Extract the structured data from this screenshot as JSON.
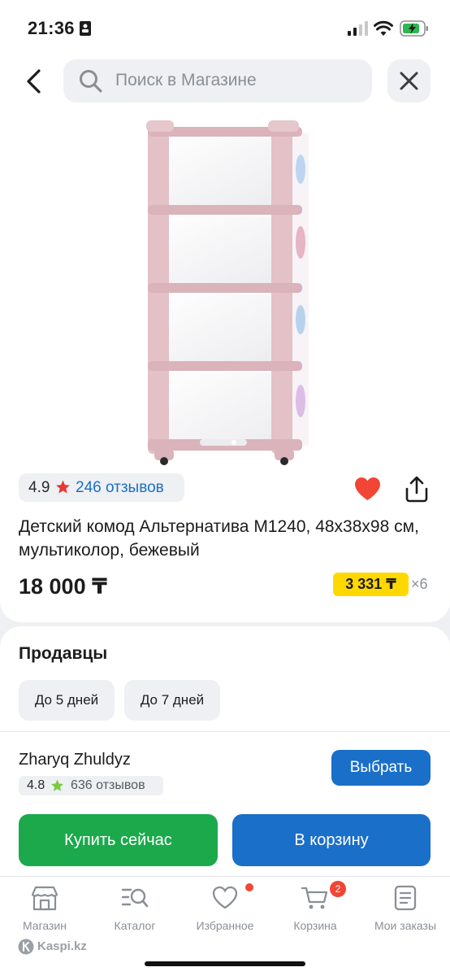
{
  "status_bar": {
    "time": "21:36"
  },
  "search": {
    "placeholder": "Поиск в Магазине"
  },
  "product": {
    "rating": "4.9",
    "reviews_link": "246 отзывов",
    "title": "Детский комод Альтернатива М1240, 48x38x98 см, мультиколор, бежевый",
    "price": "18 000 ₸",
    "installment": "3 331 ₸",
    "installment_months": "×6",
    "favorite": true
  },
  "sellers": {
    "title": "Продавцы",
    "filters": [
      "До 5 дней",
      "До 7 дней"
    ],
    "seller": {
      "name": "Zharyq Zhuldyz",
      "rating": "4.8",
      "reviews": "636 отзывов",
      "choose_label": "Выбрать"
    },
    "buy_now_label": "Купить сейчас",
    "add_to_cart_label": "В корзину"
  },
  "tabbar": {
    "items": [
      {
        "label": "Магазин",
        "icon": "store-icon"
      },
      {
        "label": "Каталог",
        "icon": "catalog-search-icon"
      },
      {
        "label": "Избранное",
        "icon": "heart-outline-icon"
      },
      {
        "label": "Корзина",
        "icon": "cart-icon",
        "badge": "2"
      },
      {
        "label": "Мои заказы",
        "icon": "orders-icon"
      }
    ]
  },
  "watermark": "Kaspi.kz",
  "colors": {
    "accent_blue": "#1a6fc9",
    "buy_green": "#1ba94c",
    "installment_yellow": "#ffd800",
    "favorite_red": "#f14635",
    "star_red": "#e53935",
    "star_green": "#7ac943"
  }
}
